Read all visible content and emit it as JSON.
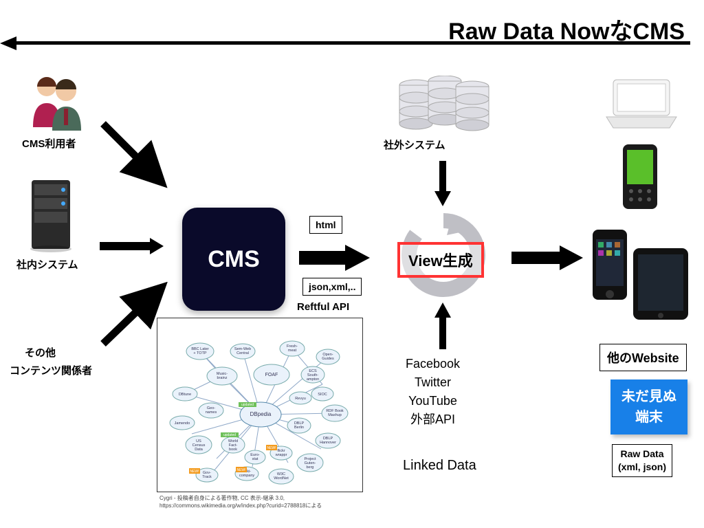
{
  "title": "Raw Data NowなCMS",
  "cms_users": "CMS利用者",
  "internal_system": "社内システム",
  "others_line1": "その他",
  "others_line2": "コンテンツ関係者",
  "cms": "CMS",
  "fmt_html": "html",
  "fmt_json": "json,xml,..",
  "restful": "Reftful API",
  "external_system": "社外システム",
  "view_gen": "View生成",
  "ext_api": {
    "l1": "Facebook",
    "l2": "Twitter",
    "l3": "YouTube",
    "l4": "外部API"
  },
  "linked_data": "Linked Data",
  "other_site": "他のWebsite",
  "unseen_l1": "未だ見ぬ",
  "unseen_l2": "端末",
  "rawdata_l1": "Raw Data",
  "rawdata_l2": "(xml, json)",
  "lod_caption1": "Cygri - 投稿者自身による著作物, CC 表示-継承 3.0,",
  "lod_caption2": "https://commons.wikimedia.org/w/index.php?curid=2788818による",
  "lod_nodes": [
    "BBC Later + TOTP",
    "Sem-Web-Central",
    "Fresh-meat",
    "Open-Guides",
    "Music-brainz",
    "FOAF",
    "ECS South-ampton",
    "DBtune",
    "SIOC",
    "Geo-names",
    "Revyu",
    "RDF Book Mashup",
    "Jamendo",
    "DBpedia",
    "DBLP Berlin",
    "US Census Data",
    "World Fact-book",
    "Euro-stat",
    "flickr wrappr",
    "DBLP Hannover",
    "Project Guten-berg",
    "Gov-Track",
    "Wiki-company",
    "W3C WordNet"
  ]
}
